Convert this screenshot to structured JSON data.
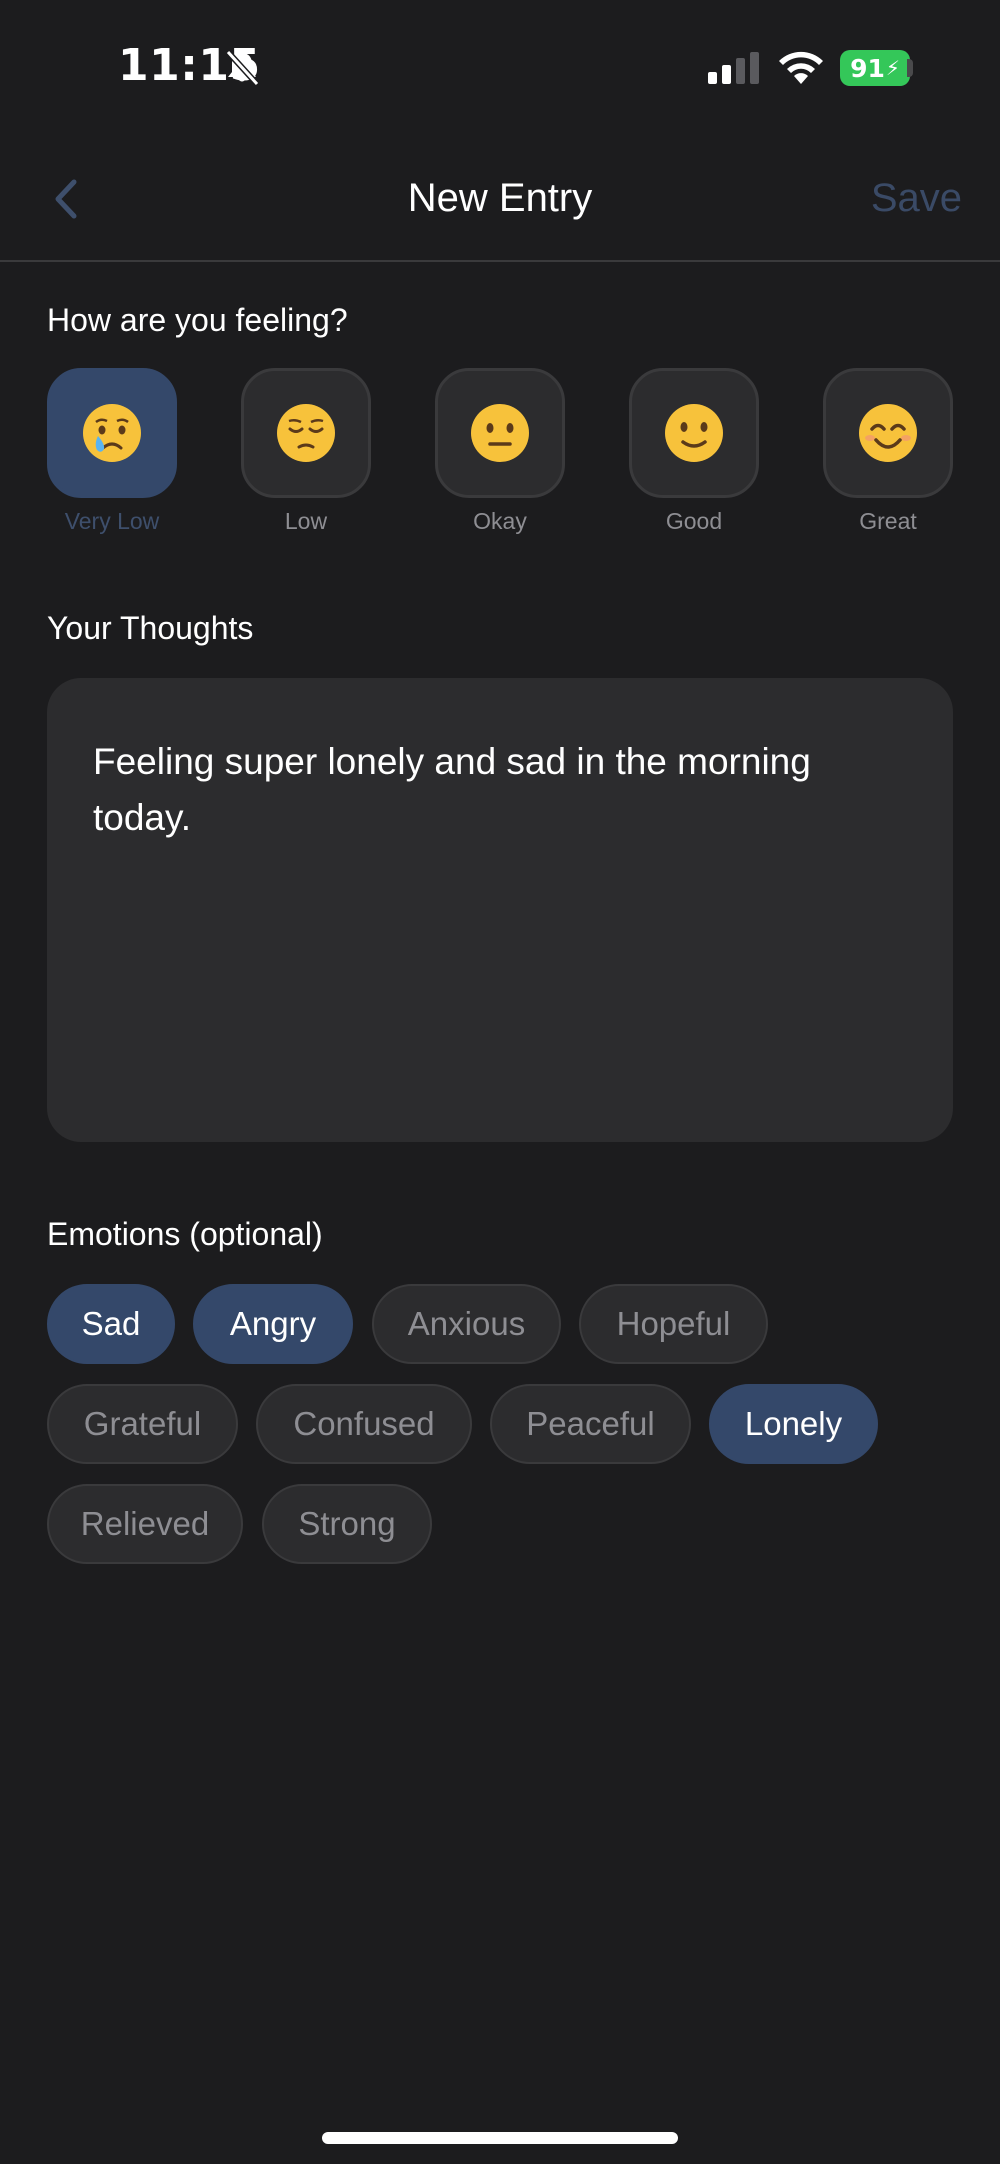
{
  "status_bar": {
    "time": "11:15",
    "battery": "91"
  },
  "nav": {
    "title": "New Entry",
    "save_label": "Save"
  },
  "mood": {
    "prompt": "How are you feeling?",
    "options": [
      {
        "label": "Very Low",
        "emoji": "crying-face",
        "selected": true
      },
      {
        "label": "Low",
        "emoji": "pensive-face",
        "selected": false
      },
      {
        "label": "Okay",
        "emoji": "neutral-face",
        "selected": false
      },
      {
        "label": "Good",
        "emoji": "slightly-smiling-face",
        "selected": false
      },
      {
        "label": "Great",
        "emoji": "smiling-face-with-smiling-eyes",
        "selected": false
      }
    ]
  },
  "thoughts": {
    "label": "Your Thoughts",
    "text": "Feeling super lonely and sad in the morning today."
  },
  "emotions": {
    "label": "Emotions (optional)",
    "chips": [
      {
        "label": "Sad",
        "selected": true
      },
      {
        "label": "Angry",
        "selected": true
      },
      {
        "label": "Anxious",
        "selected": false
      },
      {
        "label": "Hopeful",
        "selected": false
      },
      {
        "label": "Grateful",
        "selected": false
      },
      {
        "label": "Confused",
        "selected": false
      },
      {
        "label": "Peaceful",
        "selected": false
      },
      {
        "label": "Lonely",
        "selected": true
      },
      {
        "label": "Relieved",
        "selected": false
      },
      {
        "label": "Strong",
        "selected": false
      }
    ]
  },
  "colors": {
    "background": "#1c1c1e",
    "surface": "#2c2c2e",
    "accent": "#34486a",
    "battery": "#34c759"
  }
}
